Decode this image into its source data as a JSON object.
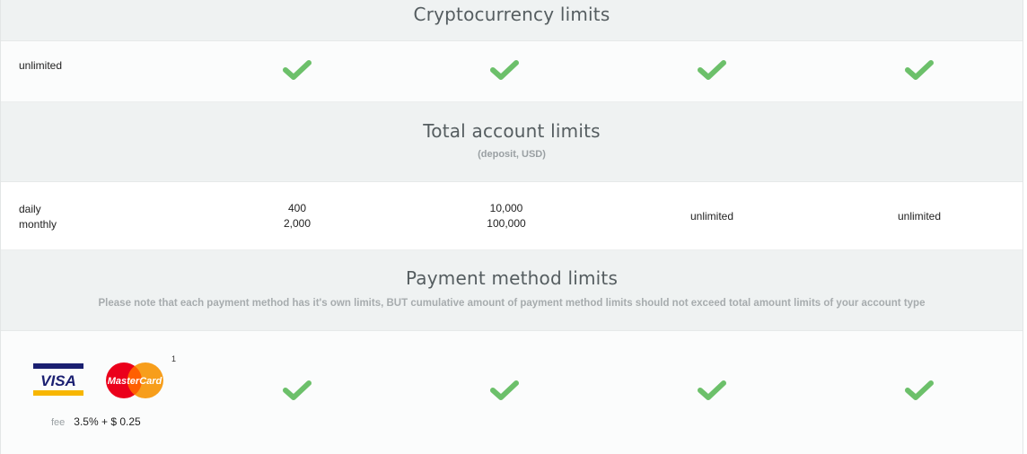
{
  "sections": {
    "crypto": {
      "title": "Cryptocurrency limits",
      "row_label": "unlimited"
    },
    "total": {
      "title": "Total account limits",
      "subtitle": "(deposit, USD)",
      "labels": [
        "daily",
        "monthly"
      ],
      "columns": [
        {
          "daily": "400",
          "monthly": "2,000"
        },
        {
          "daily": "10,000",
          "monthly": "100,000"
        },
        {
          "single": "unlimited"
        },
        {
          "single": "unlimited"
        }
      ]
    },
    "payment": {
      "title": "Payment method limits",
      "note": "Please note that each payment method has it's own limits, BUT cumulative amount of payment method limits should not exceed total amount limits of your account type",
      "visa_text": "VISA",
      "mastercard_text": "MasterCard",
      "footnote": "1",
      "fee_label": "fee",
      "fee_value": "3.5% + $ 0.25"
    }
  },
  "colors": {
    "check": "#6cc06a",
    "band": "#eff2f2",
    "visa_blue": "#1a1f71",
    "visa_gold": "#f7b600",
    "mc_red": "#eb001b",
    "mc_orange": "#f79e1b"
  },
  "icons": [
    "check-icon",
    "visa-logo",
    "mastercard-logo"
  ]
}
